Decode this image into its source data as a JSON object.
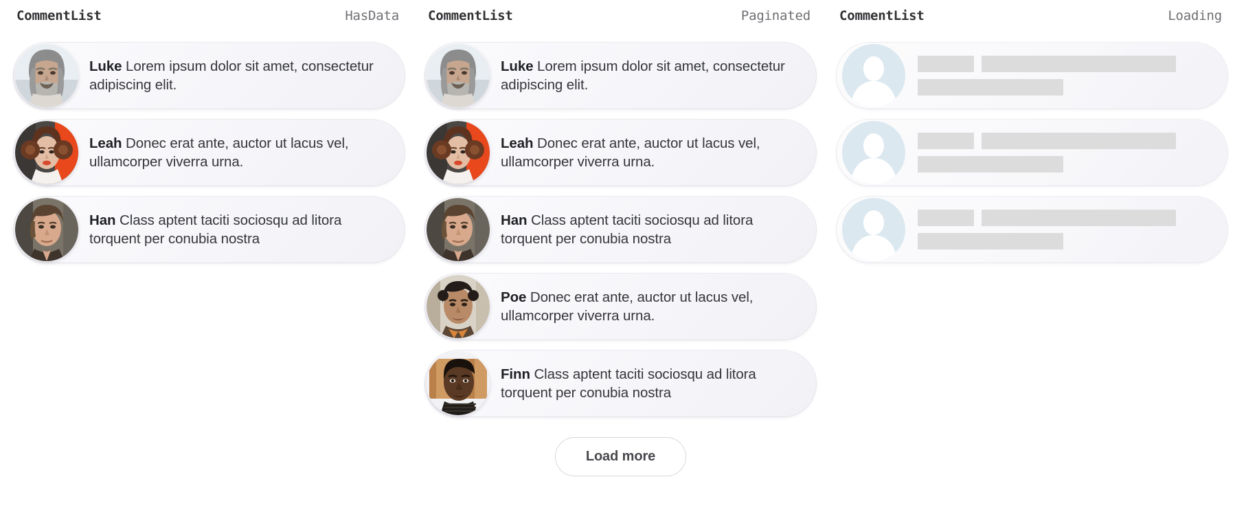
{
  "page": {
    "background": "#ffffff",
    "card_bg": "#f5f5f9",
    "skeleton_bar_color": "#dcdcdc",
    "skeleton_avatar_color": "#dce8ef",
    "author_color": "#1f2023",
    "body_color": "#35363a",
    "state_color": "#6d6f73"
  },
  "columns": [
    {
      "title": "CommentList",
      "state": "HasData",
      "comments": [
        {
          "author": "Luke",
          "body": "Lorem ipsum dolor sit amet, consectetur adipiscing elit.",
          "avatar": "luke-avatar"
        },
        {
          "author": "Leah",
          "body": "Donec erat ante, auctor ut lacus vel, ullamcorper viverra urna.",
          "avatar": "leah-avatar"
        },
        {
          "author": "Han",
          "body": "Class aptent taciti sociosqu ad litora torquent per conubia nostra",
          "avatar": "han-avatar"
        }
      ]
    },
    {
      "title": "CommentList",
      "state": "Paginated",
      "comments": [
        {
          "author": "Luke",
          "body": "Lorem ipsum dolor sit amet, consectetur adipiscing elit.",
          "avatar": "luke-avatar"
        },
        {
          "author": "Leah",
          "body": "Donec erat ante, auctor ut lacus vel, ullamcorper viverra urna.",
          "avatar": "leah-avatar"
        },
        {
          "author": "Han",
          "body": "Class aptent taciti sociosqu ad litora torquent per conubia nostra",
          "avatar": "han-avatar"
        },
        {
          "author": "Poe",
          "body": "Donec erat ante, auctor ut lacus vel, ullamcorper viverra urna.",
          "avatar": "poe-avatar"
        },
        {
          "author": "Finn",
          "body": "Class aptent taciti sociosqu ad litora torquent per conubia nostra",
          "avatar": "finn-avatar"
        }
      ],
      "load_more_label": "Load more"
    },
    {
      "title": "CommentList",
      "state": "Loading",
      "skeletons": [
        {
          "avatar": "placeholder-person-icon",
          "bars": [
            [
              124,
              326
            ],
            [
              250
            ]
          ]
        },
        {
          "avatar": "placeholder-person-icon",
          "bars": [
            [
              124,
              326
            ],
            [
              250
            ]
          ]
        },
        {
          "avatar": "placeholder-person-icon",
          "bars": [
            [
              124,
              326
            ],
            [
              250
            ]
          ]
        }
      ]
    }
  ]
}
